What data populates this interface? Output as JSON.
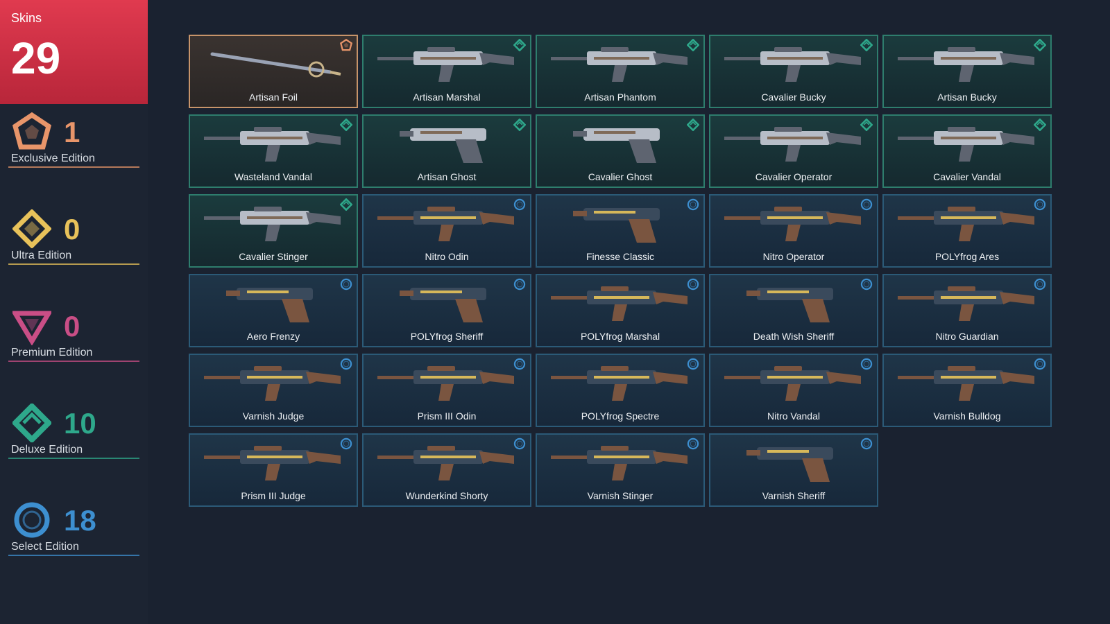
{
  "summary": {
    "label": "Skins",
    "count": "29"
  },
  "tiers": [
    {
      "label": "Exclusive Edition",
      "count": "1",
      "color": "#e8956a",
      "icon": "exclusive-edition-icon"
    },
    {
      "label": "Ultra Edition",
      "count": "0",
      "color": "#e8c25a",
      "icon": "ultra-edition-icon"
    },
    {
      "label": "Premium Edition",
      "count": "0",
      "color": "#c94e86",
      "icon": "premium-edition-icon"
    },
    {
      "label": "Deluxe Edition",
      "count": "10",
      "color": "#2ea88b",
      "icon": "deluxe-edition-icon"
    },
    {
      "label": "Select Edition",
      "count": "18",
      "color": "#3d8fd0",
      "icon": "select-edition-icon"
    }
  ],
  "skins": [
    {
      "name": "Artisan Foil",
      "tier": "exclusive"
    },
    {
      "name": "Artisan Marshal",
      "tier": "deluxe"
    },
    {
      "name": "Artisan Phantom",
      "tier": "deluxe"
    },
    {
      "name": "Cavalier Bucky",
      "tier": "deluxe"
    },
    {
      "name": "Artisan Bucky",
      "tier": "deluxe"
    },
    {
      "name": "Wasteland Vandal",
      "tier": "deluxe"
    },
    {
      "name": "Artisan Ghost",
      "tier": "deluxe"
    },
    {
      "name": "Cavalier Ghost",
      "tier": "deluxe"
    },
    {
      "name": "Cavalier Operator",
      "tier": "deluxe"
    },
    {
      "name": "Cavalier Vandal",
      "tier": "deluxe"
    },
    {
      "name": "Cavalier Stinger",
      "tier": "deluxe"
    },
    {
      "name": "Nitro Odin",
      "tier": "select"
    },
    {
      "name": "Finesse Classic",
      "tier": "select"
    },
    {
      "name": "Nitro Operator",
      "tier": "select"
    },
    {
      "name": "POLYfrog Ares",
      "tier": "select"
    },
    {
      "name": "Aero Frenzy",
      "tier": "select"
    },
    {
      "name": "POLYfrog Sheriff",
      "tier": "select"
    },
    {
      "name": "POLYfrog Marshal",
      "tier": "select"
    },
    {
      "name": "Death Wish Sheriff",
      "tier": "select"
    },
    {
      "name": "Nitro Guardian",
      "tier": "select"
    },
    {
      "name": "Varnish Judge",
      "tier": "select"
    },
    {
      "name": "Prism III Odin",
      "tier": "select"
    },
    {
      "name": "POLYfrog Spectre",
      "tier": "select"
    },
    {
      "name": "Nitro Vandal",
      "tier": "select"
    },
    {
      "name": "Varnish Bulldog",
      "tier": "select"
    },
    {
      "name": "Prism III Judge",
      "tier": "select"
    },
    {
      "name": "Wunderkind Shorty",
      "tier": "select"
    },
    {
      "name": "Varnish Stinger",
      "tier": "select"
    },
    {
      "name": "Varnish Sheriff",
      "tier": "select"
    }
  ],
  "colors": {
    "exclusive": "#e8956a",
    "ultra": "#e8c25a",
    "premium": "#c94e86",
    "deluxe": "#2ea88b",
    "select": "#3d8fd0"
  }
}
